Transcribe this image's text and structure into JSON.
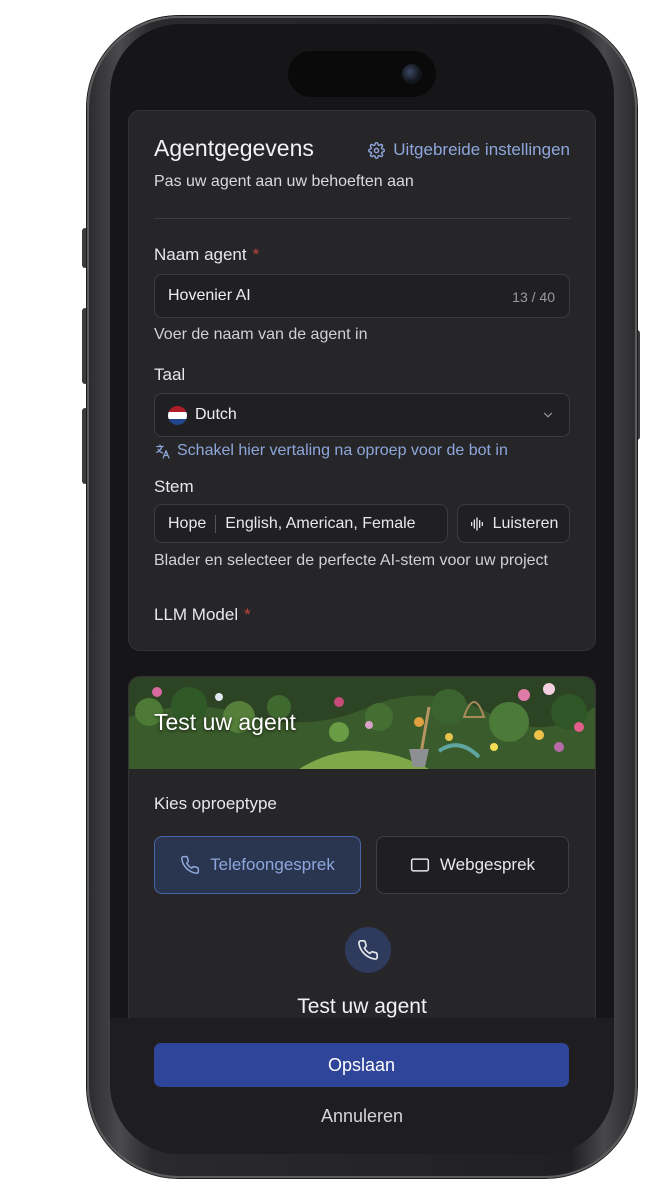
{
  "agent_details": {
    "title": "Agentgegevens",
    "advanced_settings_link": "Uitgebreide instellingen",
    "subtitle": "Pas uw agent aan uw behoeften aan",
    "name_field": {
      "label": "Naam agent",
      "required_marker": "*",
      "value": "Hovenier AI",
      "char_count": "13 / 40",
      "hint": "Voer de naam van de agent in"
    },
    "language_field": {
      "label": "Taal",
      "value": "Dutch",
      "flag_icon": "netherlands-flag",
      "translation_link": "Schakel hier vertaling na oproep voor de bot in"
    },
    "voice_field": {
      "label": "Stem",
      "voice_name": "Hope",
      "voice_description": "English, American, Female",
      "listen_button": "Luisteren",
      "hint": "Blader en selecteer de perfecte AI-stem voor uw project"
    },
    "llm_field": {
      "label": "LLM Model",
      "required_marker": "*"
    }
  },
  "test_agent": {
    "banner_title": "Test uw agent",
    "call_type_label": "Kies oproeptype",
    "options": [
      {
        "label": "Telefoongesprek",
        "icon": "phone-icon",
        "selected": true
      },
      {
        "label": "Webgesprek",
        "icon": "browser-window-icon",
        "selected": false
      }
    ],
    "start_label": "Test uw agent"
  },
  "footer": {
    "save_button": "Opslaan",
    "cancel_button": "Annuleren"
  },
  "colors": {
    "accent": "#8ea6dc",
    "primary_button": "#2f4599",
    "required": "#c0453e",
    "card_bg": "#262628"
  }
}
